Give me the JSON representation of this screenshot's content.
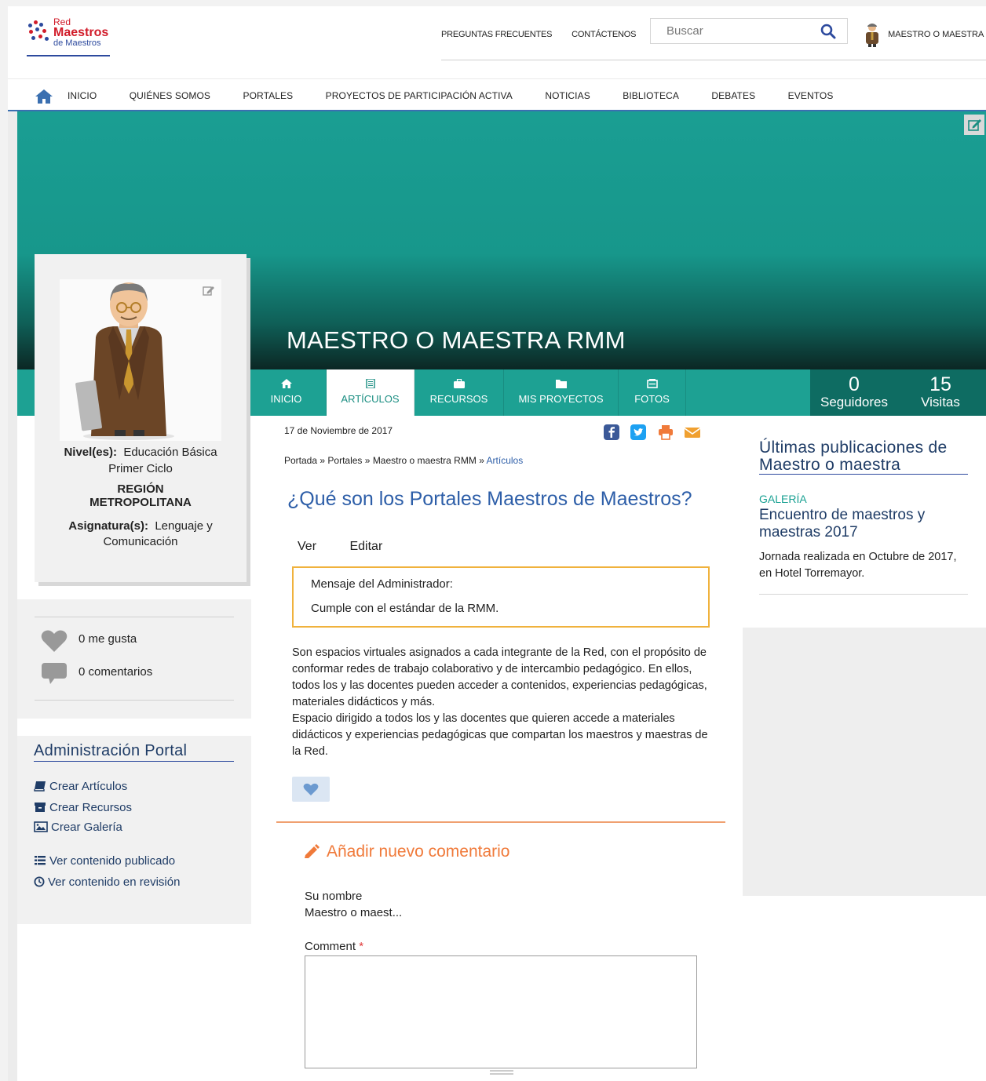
{
  "header": {
    "logo": {
      "line1": "Red",
      "line2": "Maestros",
      "line3": "de Maestros"
    },
    "links": [
      "PREGUNTAS FRECUENTES",
      "CONTÁCTENOS"
    ],
    "search_placeholder": "Buscar",
    "user_name": "MAESTRO O MAESTRA ..."
  },
  "mainnav": {
    "items": [
      "INICIO",
      "QUIÉNES SOMOS",
      "PORTALES",
      "PROYECTOS DE PARTICIPACIÓN ACTIVA",
      "NOTICIAS",
      "BIBLIOTECA",
      "DEBATES",
      "EVENTOS"
    ]
  },
  "portal": {
    "title": "MAESTRO O MAESTRA RMM",
    "tabs": [
      {
        "label": "INICIO",
        "icon": "home-icon"
      },
      {
        "label": "ARTÍCULOS",
        "icon": "article-icon"
      },
      {
        "label": "RECURSOS",
        "icon": "briefcase-icon"
      },
      {
        "label": "MIS PROYECTOS",
        "icon": "folder-icon"
      },
      {
        "label": "FOTOS",
        "icon": "photos-icon"
      }
    ],
    "active_tab": "ARTÍCULOS",
    "stats": [
      {
        "value": "0",
        "label": "Seguidores"
      },
      {
        "value": "15",
        "label": "Visitas"
      }
    ]
  },
  "profile": {
    "nivel_label": "Nivel(es):",
    "nivel_value": "Educación Básica",
    "nivel_value2": "Primer Ciclo",
    "region1": "REGIÓN",
    "region2": "METROPOLITANA",
    "asignatura_label": "Asignatura(s):",
    "asignatura_value": "Lenguaje y",
    "asignatura_value2": "Comunicación"
  },
  "engagement": {
    "likes": "0 me gusta",
    "comments": "0 comentarios"
  },
  "admin": {
    "title": "Administración Portal",
    "links": [
      "Crear Artículos",
      "Crear Recursos",
      "Crear Galería",
      "Ver contenido publicado",
      "Ver contenido en revisión"
    ]
  },
  "article": {
    "date": "17 de Noviembre de 2017",
    "breadcrumb": [
      "Portada",
      "Portales",
      "Maestro o maestra RMM",
      "Artículos"
    ],
    "breadcrumb_sep": "»",
    "title": "¿Qué son los Portales Maestros de Maestros?",
    "view_tabs": [
      "Ver",
      "Editar"
    ],
    "admin_message_label": "Mensaje del Administrador:",
    "admin_message": "Cumple con el estándar de la RMM.",
    "body": "Son espacios virtuales asignados a cada integrante de la Red, con el propósito de conformar redes de trabajo colaborativo y de intercambio pedagógico. En ellos, todos los y las docentes pueden acceder a contenidos, experiencias pedagógicas, materiales didácticos y más.",
    "body2": "Espacio dirigido a todos los y las docentes que quieren accede a materiales didácticos y experiencias pedagógicas que compartan los maestros y maestras de la Red."
  },
  "comment_form": {
    "heading": "Añadir nuevo comentario",
    "name_label": "Su nombre",
    "name_value": "Maestro o maest...",
    "comment_label": "Comment",
    "required_mark": "*"
  },
  "sidebar_right": {
    "title": "Últimas publicaciones de Maestro o maestra",
    "category": "GALERÍA",
    "item_title": "Encuentro de maestros y maestras 2017",
    "item_desc": "Jornada realizada en Octubre de 2017, en Hotel Torremayor."
  },
  "colors": {
    "teal": "#1da193",
    "dark_teal": "#0e6c62",
    "link_blue": "#2d5ea8",
    "navy": "#1f3c66",
    "orange": "#f07a3a",
    "border_orange": "#f0b23d"
  }
}
